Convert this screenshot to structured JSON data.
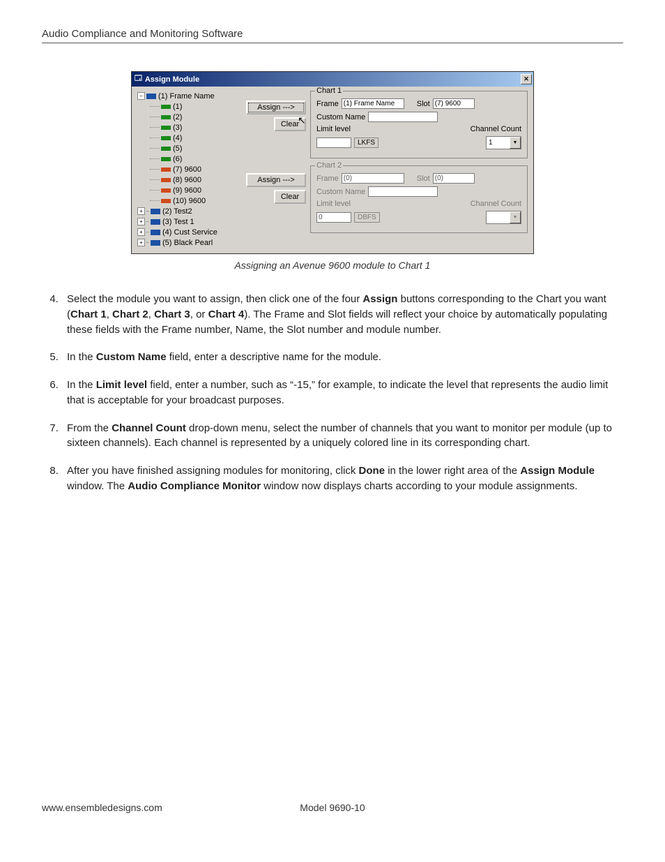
{
  "header": {
    "title": "Audio Compliance and Monitoring Software"
  },
  "window": {
    "title": "Assign Module",
    "tree": {
      "root": "(1) Frame Name",
      "slots": [
        "(1)",
        "(2)",
        "(3)",
        "(4)",
        "(5)",
        "(6)",
        "(7) 9600",
        "(8) 9600",
        "(9) 9600",
        "(10) 9600"
      ],
      "frames": [
        "(2) Test2",
        "(3) Test 1",
        "(4) Cust Service",
        "(5) Black Pearl"
      ]
    },
    "buttons": {
      "assign": "Assign --->",
      "clear": "Clear"
    },
    "chart1": {
      "legend": "Chart 1",
      "frame_label": "Frame",
      "frame_value": "(1) Frame Name",
      "slot_label": "Slot",
      "slot_value": "(7) 9600",
      "custom_label": "Custom Name",
      "custom_value": "",
      "limit_label": "Limit level",
      "limit_value": "",
      "unit": "LKFS",
      "count_label": "Channel Count",
      "count_value": "1"
    },
    "chart2": {
      "legend": "Chart 2",
      "frame_label": "Frame",
      "frame_value": "(0)",
      "slot_label": "Slot",
      "slot_value": "(0)",
      "custom_label": "Custom Name",
      "custom_value": "",
      "limit_label": "Limit level",
      "limit_value": "0",
      "unit": "DBFS",
      "count_label": "Channel Count",
      "count_value": ""
    }
  },
  "caption": "Assigning an Avenue 9600 module to Chart 1",
  "steps": {
    "s4a": "Select the module you want to assign, then click one of the four ",
    "s4b": "Assign",
    "s4c": " buttons corresponding to the Chart you want (",
    "s4d": "Chart 1",
    "s4e": ", ",
    "s4f": "Chart 2",
    "s4g": ", ",
    "s4h": "Chart 3",
    "s4i": ", or ",
    "s4j": "Chart 4",
    "s4k": "). The Frame and Slot fields will reflect your choice by automatically populating these fields with the Frame number, Name, the Slot number and module number.",
    "s5a": "In the ",
    "s5b": "Custom Name",
    "s5c": " field, enter a descriptive name for the module.",
    "s6a": "In the ",
    "s6b": "Limit level",
    "s6c": " field, enter a number, such as “-15,” for example, to indicate the level that represents the audio limit that is acceptable for your broadcast purposes.",
    "s7a": "From the ",
    "s7b": "Channel Count",
    "s7c": " drop-down menu, select the number of channels that you want to monitor per module (up to sixteen channels). Each channel is represented by a uniquely colored line in its corresponding chart.",
    "s8a": "After you have finished assigning modules for monitoring, click ",
    "s8b": "Done",
    "s8c": " in the lower right area of the ",
    "s8d": "Assign Module",
    "s8e": " window. The ",
    "s8f": "Audio Compliance Monitor",
    "s8g": " window now displays charts according to your module assignments."
  },
  "footer": {
    "url": "www.ensembledesigns.com",
    "model": "Model 9690-10"
  }
}
